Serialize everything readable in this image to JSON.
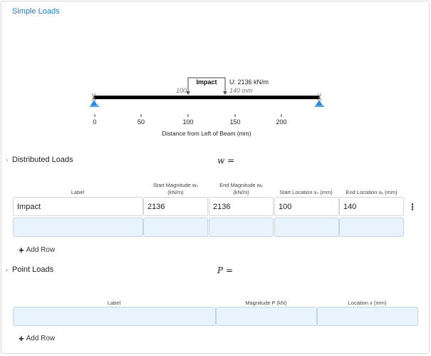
{
  "page": {
    "title": "Simple Loads"
  },
  "diagram": {
    "load_label": "Impact",
    "magnitude_text": "U: 2136 kN/m",
    "start_text": "100",
    "end_text": "140 mm",
    "ticks": [
      "0",
      "50",
      "100",
      "150",
      "200"
    ],
    "axis_title": "Distance from Left of Beam (mm)"
  },
  "distributed": {
    "heading": "Distributed Loads",
    "formula": "w =",
    "columns": {
      "label": "Label",
      "start_mag_1": "Start Magnitude wₛ",
      "start_mag_2": "(kN/m)",
      "end_mag_1": "End Magnitude wₑ",
      "end_mag_2": "(kN/m)",
      "start_loc": "Start Location xₛ (mm)",
      "end_loc": "End Location xₑ (mm)"
    },
    "rows": [
      {
        "label": "Impact",
        "start_mag": "2136",
        "end_mag": "2136",
        "start_loc": "100",
        "end_loc": "140"
      }
    ],
    "add_row": "Add Row"
  },
  "point": {
    "heading": "Point Loads",
    "formula": "P =",
    "columns": {
      "label": "Label",
      "magnitude": "Magnitude P (kN)",
      "location": "Location x (mm)"
    },
    "add_row": "Add Row"
  }
}
